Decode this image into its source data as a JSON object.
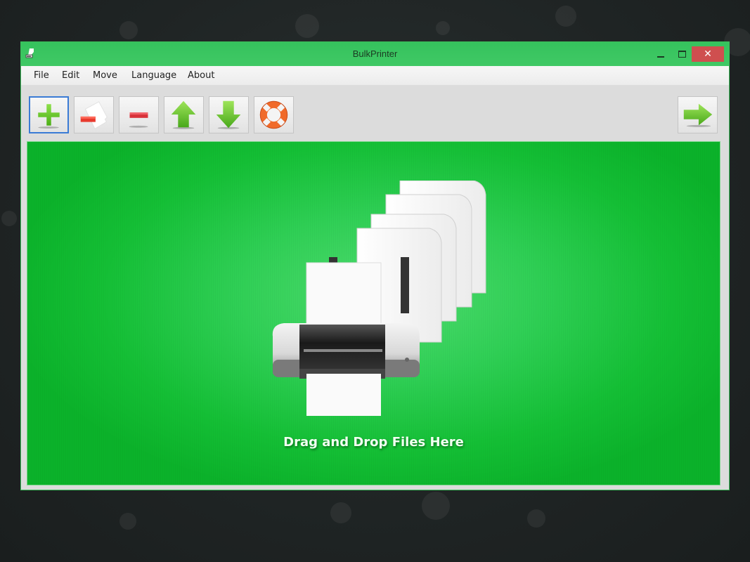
{
  "window": {
    "title": "BulkPrinter",
    "controls": {
      "minimize": "minimize",
      "maximize": "maximize",
      "close": "✕"
    }
  },
  "menu": {
    "items": [
      "File",
      "Edit",
      "Move",
      "Language",
      "About"
    ]
  },
  "toolbar": {
    "buttons": [
      {
        "name": "add-files-button",
        "icon": "plus-icon"
      },
      {
        "name": "remove-file-button",
        "icon": "remove-document-icon"
      },
      {
        "name": "remove-button",
        "icon": "minus-icon"
      },
      {
        "name": "move-up-button",
        "icon": "arrow-up-icon"
      },
      {
        "name": "move-down-button",
        "icon": "arrow-down-icon"
      },
      {
        "name": "help-button",
        "icon": "lifebuoy-icon"
      },
      {
        "name": "next-button",
        "icon": "arrow-right-icon"
      }
    ]
  },
  "drop_area": {
    "label": "Drag and Drop Files Here",
    "icon": "printer-with-documents-icon"
  },
  "colors": {
    "titlebar": "#3cc561",
    "accent_green": "#14bf35",
    "close_button": "#cf4f4f",
    "active_border": "#3a7bd5"
  }
}
